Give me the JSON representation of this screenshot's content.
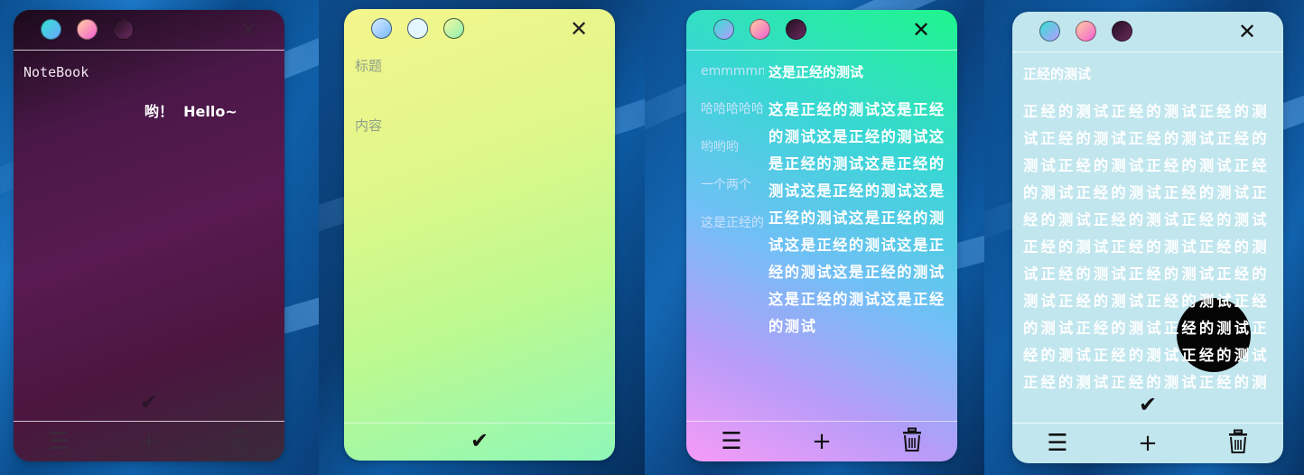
{
  "notes": [
    {
      "id": "note-dark",
      "title": "NoteBook",
      "body": "哟！  Hello~",
      "close_icon": "close-icon",
      "toolbar": {
        "menu": "☰",
        "add": "+",
        "trash": "trash-icon"
      },
      "colors": {
        "text": "#ffffff",
        "close": "#3a2038"
      }
    },
    {
      "id": "note-editor",
      "title_placeholder": "标题",
      "content_placeholder": "内容",
      "close_icon": "close-icon",
      "confirm_icon": "check-icon",
      "colors": {
        "text": "#8f9f8a"
      }
    },
    {
      "id": "note-list",
      "list_items": [
        "emmmmm",
        "哈哈哈哈哈",
        "哟哟哟",
        "一个两个",
        "这是正经的"
      ],
      "title": "这是正经的测试",
      "body": "这是正经的测试这是正经的测试这是正经的测试这是正经的测试这是正经的测试这是正经的测试这是正经的测试这是正经的测试这是正经的测试这是正经的测试这是正经的测试这是正经的测试这是正经的测试",
      "toolbar": {
        "menu": "☰",
        "add": "+",
        "trash": "trash-icon"
      }
    },
    {
      "id": "note-light",
      "title": "正经的测试",
      "body": "正经的测试正经的测试正经的测试正经的测试正经的测试正经的测试正经的测试正经的测试正经的测试正经的测试正经的测试正经的测试正经的测试正经的测试正经的测试正经的测试正经的测试正经的测试正经的测试正经的测试正经的测试正经的测试正经的测试正经的测试正经的测试正经的测试正经的测试正经的测试正经的测试正经的测试正经的测试正经的测试正经的测试",
      "toolbar": {
        "menu": "☰",
        "add": "+",
        "trash": "trash-icon"
      }
    }
  ],
  "color_dots": {
    "dark_theme": [
      "#3ed6f2",
      "#f98ad2",
      "#4a1a46"
    ],
    "light_theme": [
      "#a8d4ff",
      "#dff3ff",
      "#b6f7a6"
    ]
  },
  "icons": {
    "close": "✕",
    "check": "✔",
    "menu": "☰",
    "add": "+"
  }
}
